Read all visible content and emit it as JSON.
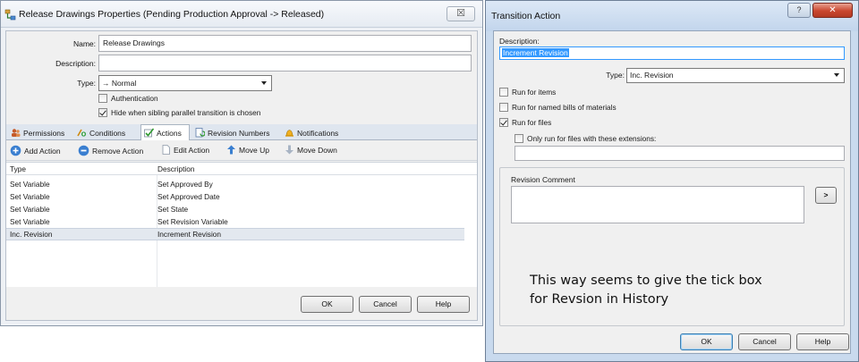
{
  "left_window": {
    "title": "Release Drawings Properties (Pending Production Approval -> Released)",
    "close_label": "☒",
    "name_label": "Name:",
    "name_value": "Release Drawings",
    "description_label": "Description:",
    "description_value": "",
    "type_label": "Type:",
    "type_value": "→ Normal",
    "authentication_label": "Authentication",
    "authentication_checked": false,
    "hide_sibling_label": "Hide when sibling parallel transition is chosen",
    "hide_sibling_checked": true,
    "tabs": [
      {
        "label": "Permissions",
        "icon": "users-icon"
      },
      {
        "label": "Conditions",
        "icon": "conditions-icon"
      },
      {
        "label": "Actions",
        "icon": "check-icon",
        "active": true
      },
      {
        "label": "Revision Numbers",
        "icon": "revision-icon"
      },
      {
        "label": "Notifications",
        "icon": "bell-icon"
      }
    ],
    "toolbar": {
      "add": "Add Action",
      "remove": "Remove Action",
      "edit": "Edit Action",
      "move_up": "Move Up",
      "move_down": "Move Down"
    },
    "columns": [
      "Type",
      "Description"
    ],
    "rows": [
      {
        "type": "Set Variable",
        "description": "Set Approved By"
      },
      {
        "type": "Set Variable",
        "description": "Set Approved Date"
      },
      {
        "type": "Set Variable",
        "description": "Set State"
      },
      {
        "type": "Set Variable",
        "description": "Set Revision Variable"
      },
      {
        "type": "Inc. Revision",
        "description": "Increment Revision"
      }
    ],
    "selected_row_index": 4,
    "buttons": {
      "ok": "OK",
      "cancel": "Cancel",
      "help": "Help"
    }
  },
  "right_window": {
    "title": "Transition Action",
    "help_label": "?",
    "close_label": "✕",
    "description_label": "Description:",
    "description_value": "Increment Revision",
    "type_label": "Type:",
    "type_value": "Inc. Revision",
    "run_for_items_label": "Run for items",
    "run_for_items_checked": false,
    "run_for_boms_label": "Run for named bills of materials",
    "run_for_boms_checked": false,
    "run_for_files_label": "Run for files",
    "run_for_files_checked": true,
    "only_extensions_label": "Only run for files with these extensions:",
    "only_extensions_checked": false,
    "extensions_value": "",
    "revision_comment_label": "Revision Comment",
    "revision_comment_value": "",
    "expand_button": ">",
    "note_line1": "This way seems to give the tick box",
    "note_line2": "for Revsion in History",
    "buttons": {
      "ok": "OK",
      "cancel": "Cancel",
      "help": "Help"
    }
  },
  "colors": {
    "selection_blue": "#3399ff",
    "close_red": "#c9462e",
    "window_frame": "#c9daee"
  }
}
